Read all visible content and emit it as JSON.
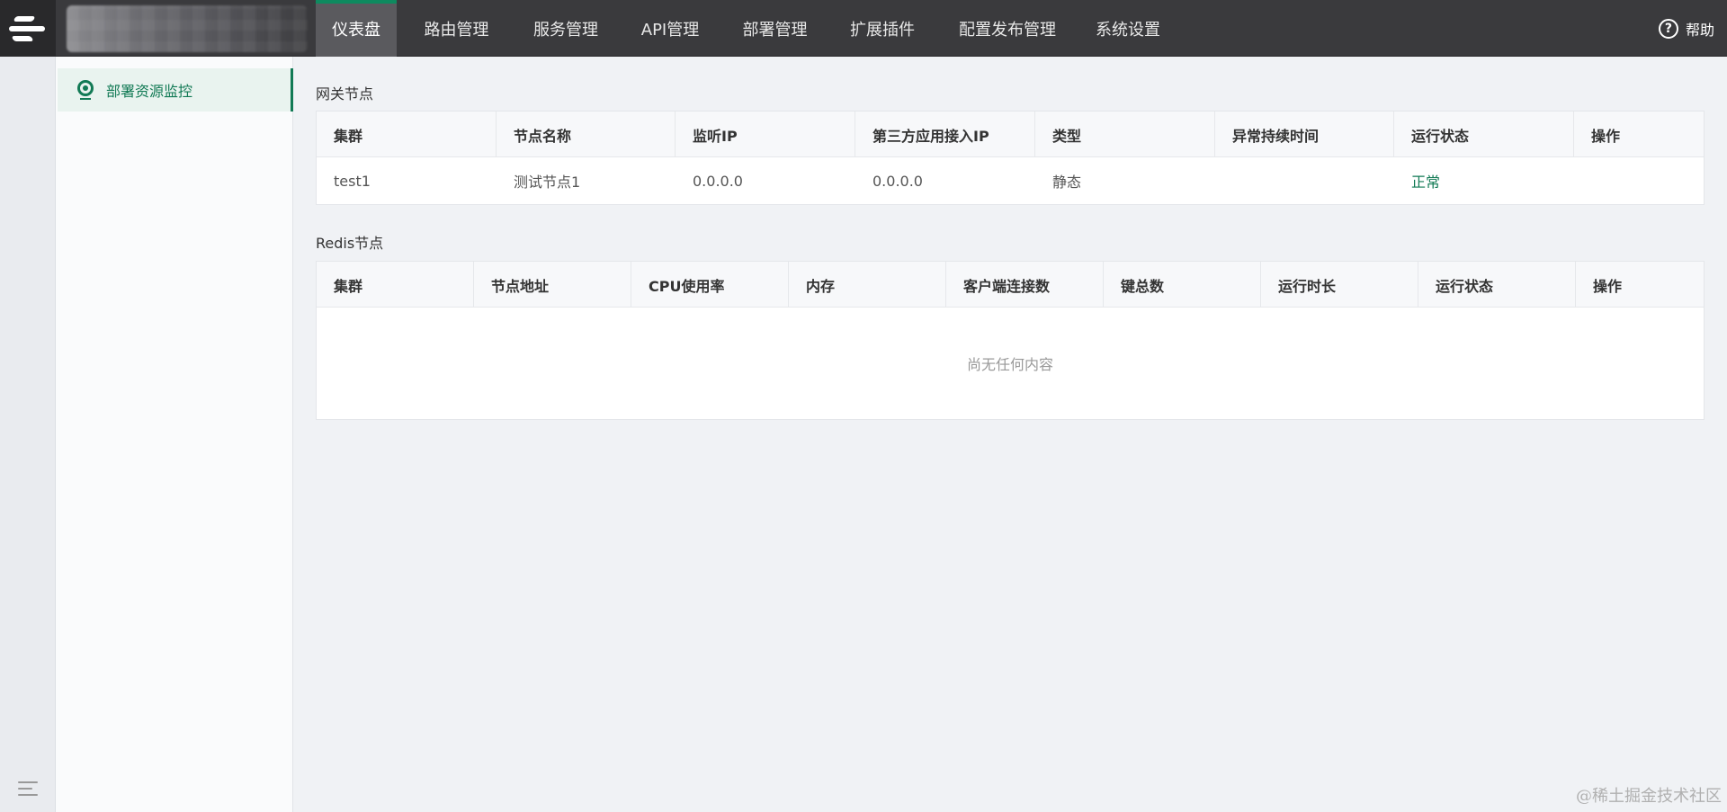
{
  "topbar": {
    "nav": [
      {
        "label": "仪表盘",
        "active": true
      },
      {
        "label": "路由管理",
        "active": false
      },
      {
        "label": "服务管理",
        "active": false
      },
      {
        "label": "API管理",
        "active": false
      },
      {
        "label": "部署管理",
        "active": false
      },
      {
        "label": "扩展插件",
        "active": false
      },
      {
        "label": "配置发布管理",
        "active": false
      },
      {
        "label": "系统设置",
        "active": false
      }
    ],
    "help_label": "帮助",
    "help_icon": "question-circle-icon"
  },
  "subnav": {
    "items": [
      {
        "label": "部署资源监控",
        "icon": "location-pin-icon",
        "active": true
      }
    ]
  },
  "gateway": {
    "title": "网关节点",
    "columns": [
      "集群",
      "节点名称",
      "监听IP",
      "第三方应用接入IP",
      "类型",
      "异常持续时间",
      "运行状态",
      "操作"
    ],
    "rows": [
      [
        "test1",
        "测试节点1",
        "0.0.0.0",
        "0.0.0.0",
        "静态",
        "",
        "正常",
        ""
      ]
    ]
  },
  "redis": {
    "title": "Redis节点",
    "columns": [
      "集群",
      "节点地址",
      "CPU使用率",
      "内存",
      "客户端连接数",
      "键总数",
      "运行时长",
      "运行状态",
      "操作"
    ],
    "empty_text": "尚无任何内容"
  },
  "watermark": "@稀土掘金技术社区",
  "colors": {
    "accent": "#127a55",
    "topbar": "#3a3a3d",
    "nav_active": "#5a5a5e"
  }
}
